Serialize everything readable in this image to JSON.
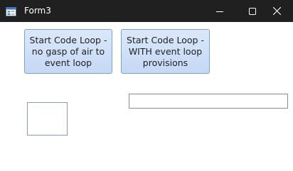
{
  "window": {
    "title": "Form3",
    "controls": {
      "minimize_icon": "minimize-icon",
      "maximize_icon": "maximize-icon",
      "close_icon": "close-icon"
    },
    "colors": {
      "titlebar": "#202020",
      "button_fill": "#c4d8f5",
      "button_border": "#7da2ce"
    }
  },
  "buttons": {
    "loop_no_gasp": "Start Code Loop -\nno gasp of air to\nevent loop",
    "loop_with_provisions": "Start Code Loop -\nWITH event loop\nprovisions"
  },
  "text_field": {
    "value": ""
  }
}
